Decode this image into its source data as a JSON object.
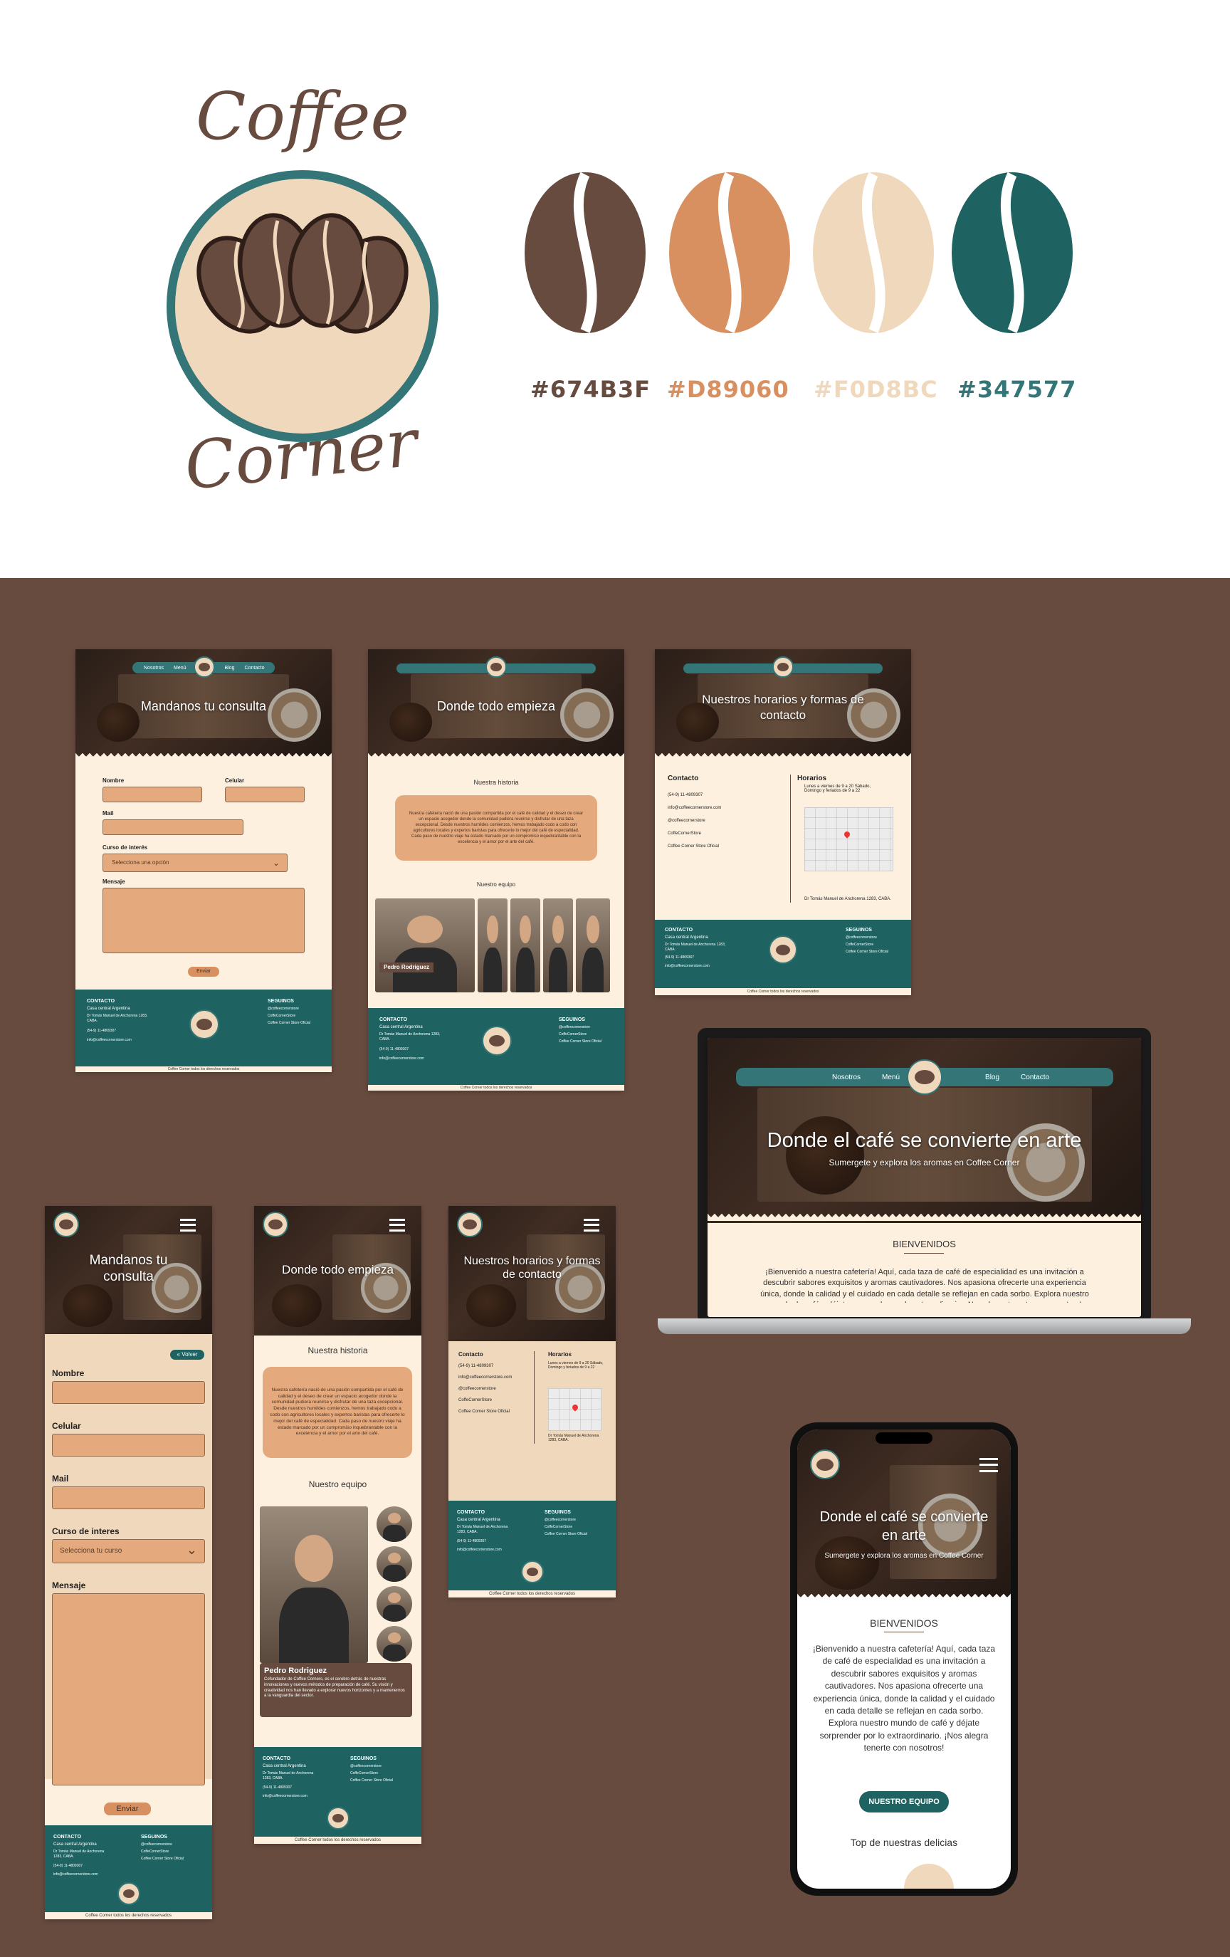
{
  "brand": {
    "logo_word1": "Coffee",
    "logo_word2": "Corner",
    "palette": [
      {
        "hex": "#674B3F",
        "color": "#674b3f"
      },
      {
        "hex": "#D89060",
        "color": "#d89060"
      },
      {
        "hex": "#F0D8BC",
        "color": "#f0d8bc"
      },
      {
        "hex": "#347577",
        "color": "#347577"
      }
    ]
  },
  "nav": {
    "nosotros": "Nosotros",
    "menu": "Menú",
    "blog": "Blog",
    "contacto": "Contacto"
  },
  "pages": {
    "consulta_title": "Mandanos tu consulta",
    "historia_title": "Donde todo empieza",
    "horarios_title": "Nuestros horarios y formas de contacto",
    "home_title": "Donde el café se convierte en arte",
    "home_subtitle": "Sumergete y explora los aromas en Coffee Corner"
  },
  "form": {
    "nombre": "Nombre",
    "celular": "Celular",
    "mail": "Mail",
    "curso": "Curso de interés",
    "curso_mobile": "Curso de interes",
    "select_placeholder": "Selecciona una opción",
    "select_placeholder_mobile": "Selecciona tu curso",
    "mensaje": "Mensaje",
    "enviar": "Enviar",
    "volver": "Volver"
  },
  "historia": {
    "heading": "Nuestra historia",
    "team_heading": "Nuestro equipo",
    "text": "Nuestra cafetería nació de una pasión compartida por el café de calidad y el deseo de crear un espacio acogedor donde la comunidad pudiera reunirse y disfrutar de una taza excepcional. Desde nuestros humildes comienzos, hemos trabajado codo a codo con agricultores locales y expertos baristas para ofrecerte lo mejor del café de especialidad. Cada paso de nuestro viaje ha estado marcado por un compromiso inquebrantable con la excelencia y el amor por el arte del café.",
    "member_name": "Pedro Rodriguez",
    "member_bio": "Cofundador de Coffee Corners, es el cerebro detrás de nuestras innovaciones y nuevos métodos de preparación de café. Su visión y creatividad nos han llevado a explorar nuevos horizontes y a mantenernos a la vanguardia del sector."
  },
  "contacto": {
    "heading": "Contacto",
    "phone": "(54-9) 11-4809307",
    "email": "info@coffeecornerstore.com",
    "instagram": "@coffeecornerstore",
    "facebook": "CoffeCornerStore",
    "store": "Coffee Corner Store Oficial",
    "horarios_heading": "Horarios",
    "horarios_text": "Lunes a viernes de 9 a 20 Sábado, Domingo y feriados de 9 a 22",
    "address": "Dr Tomás Manuel de Anchorena 1283, CABA."
  },
  "footer": {
    "contacto": "CONTACTO",
    "casa": "Casa central Argentina",
    "casa_addr": "Dr Tomás Manuel de Anchorena 1283, CABA.",
    "seguinos": "SEGUINOS",
    "copyright": "Coffee Corner todos los derechos reservados"
  },
  "home": {
    "bienvenidos": "BIENVENIDOS",
    "welcome_text": "¡Bienvenido a nuestra cafetería! Aquí, cada taza de café de especialidad es una invitación a descubrir sabores exquisitos y aromas cautivadores. Nos apasiona ofrecerte una experiencia única, donde la calidad y el cuidado en cada detalle se reflejan en cada sorbo. Explora nuestro mundo de café y déjate sorprender por lo extraordinario. ¡Nos alegra tenerte con nosotros!",
    "team_button": "NUESTRO EQUIPO",
    "top_delicias": "Top de nuestras delicias"
  }
}
